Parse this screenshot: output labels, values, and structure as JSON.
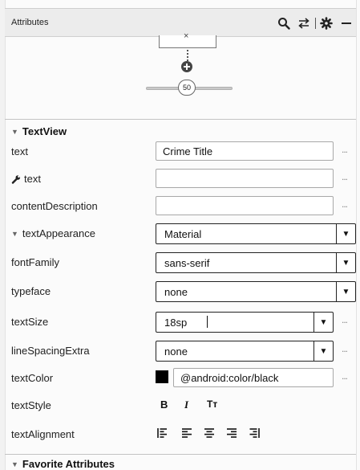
{
  "header": {
    "title": "Attributes",
    "icons": [
      "search-icon",
      "swap-arrows-icon",
      "gear-icon",
      "minimize-icon"
    ]
  },
  "preview": {
    "top_box_symbol": "×",
    "slider_value": "50"
  },
  "sections": {
    "textview": {
      "title": "TextView"
    },
    "favorites": {
      "title": "Favorite Attributes"
    }
  },
  "attributes": {
    "text": {
      "label": "text",
      "value": "Crime Title"
    },
    "tools_text": {
      "label": "text",
      "value": "",
      "icon": "wrench-icon"
    },
    "content_description": {
      "label": "contentDescription",
      "value": ""
    },
    "text_appearance": {
      "label": "textAppearance",
      "value": "Material"
    },
    "font_family": {
      "label": "fontFamily",
      "value": "sans-serif"
    },
    "typeface": {
      "label": "typeface",
      "value": "none"
    },
    "text_size": {
      "label": "textSize",
      "value": "18sp"
    },
    "line_spacing_extra": {
      "label": "lineSpacingExtra",
      "value": "none"
    },
    "text_color": {
      "label": "textColor",
      "value": "@android:color/black",
      "swatch": "#000000"
    },
    "text_style": {
      "label": "textStyle",
      "options": [
        "B",
        "I",
        "Tт"
      ]
    },
    "text_alignment": {
      "label": "textAlignment",
      "options": [
        "align-start-icon",
        "align-left-icon",
        "align-center-icon",
        "align-right-icon",
        "align-end-icon"
      ]
    }
  },
  "more_label": "...",
  "colors": {
    "header_bg": "#ececec",
    "panel_bg": "#fbfbfb",
    "border": "#a8a8a8",
    "text": "#1c1c1c"
  }
}
